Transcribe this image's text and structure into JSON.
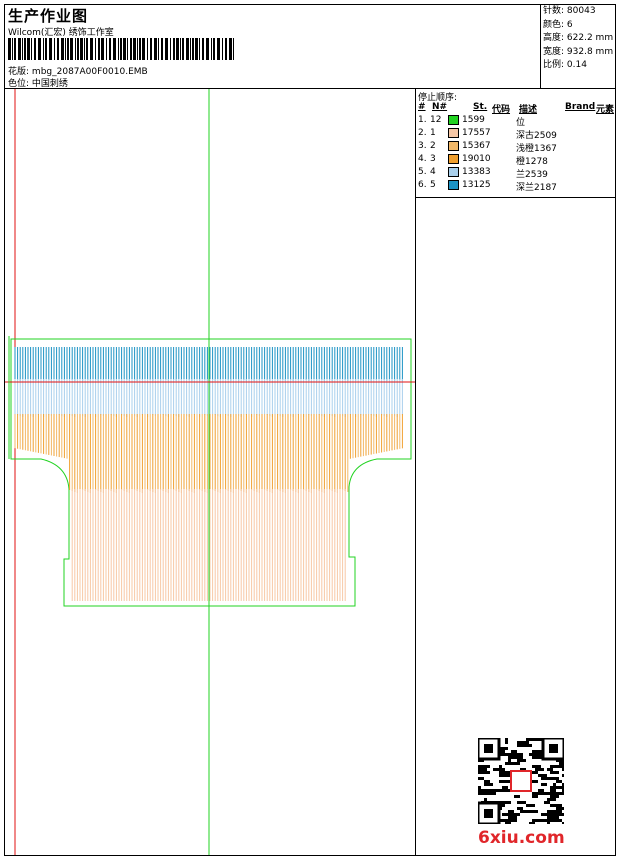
{
  "header": {
    "title": "生产作业图",
    "company": "Wilcom(汇宏) 绣饰工作室",
    "design_label": "花版:",
    "design_name": "mbg_2087A00F0010.EMB",
    "color_label": "色位:",
    "color_value": "中国刺绣"
  },
  "specs": [
    {
      "label": "针数:",
      "value": "80043"
    },
    {
      "label": "颜色:",
      "value": "6"
    },
    {
      "label": "高度:",
      "value": "622.2 mm"
    },
    {
      "label": "宽度:",
      "value": "932.8 mm"
    },
    {
      "label": "比例:",
      "value": "0.14"
    }
  ],
  "sequence": {
    "title": "停止顺序:",
    "columns": [
      "#",
      "N#",
      "St.",
      "代码",
      "描述",
      "Brand",
      "元素"
    ],
    "rows": [
      {
        "idx": "1.",
        "n": "12",
        "color": "#22d322",
        "st": "1599",
        "desc": "位"
      },
      {
        "idx": "2.",
        "n": "1",
        "color": "#f7c8a6",
        "st": "17557",
        "desc": "深古2509"
      },
      {
        "idx": "3.",
        "n": "2",
        "color": "#f2b868",
        "st": "15367",
        "desc": "浅橙1367"
      },
      {
        "idx": "4.",
        "n": "3",
        "color": "#f0a030",
        "st": "19010",
        "desc": "橙1278"
      },
      {
        "idx": "5.",
        "n": "4",
        "color": "#a9d0ec",
        "st": "13383",
        "desc": "兰2539"
      },
      {
        "idx": "6.",
        "n": "5",
        "color": "#1c93c4",
        "st": "13125",
        "desc": "深兰2187"
      }
    ]
  },
  "colors": {
    "outline": "#22d322",
    "axis_red": "#e01010",
    "dark_blue": "#1c93c4",
    "light_blue": "#a9d0ec",
    "orange": "#f0a030",
    "light_orange": "#f2b868",
    "peach": "#f7c8a6"
  },
  "watermark": {
    "text": "6xiu.com"
  }
}
